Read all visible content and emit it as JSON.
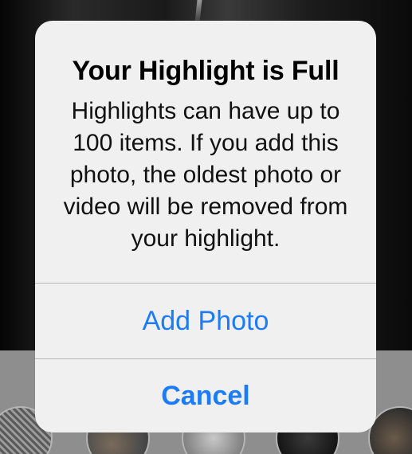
{
  "alert": {
    "title": "Your Highlight is Full",
    "message": "Highlights can have up to 100 items. If you add this photo, the oldest photo or video will be removed from your highlight.",
    "buttons": {
      "add_photo": "Add Photo",
      "cancel": "Cancel"
    }
  },
  "colors": {
    "accent": "#1d7cf5",
    "alert_background": "#f0f0f0",
    "divider": "#b8b8b8"
  }
}
